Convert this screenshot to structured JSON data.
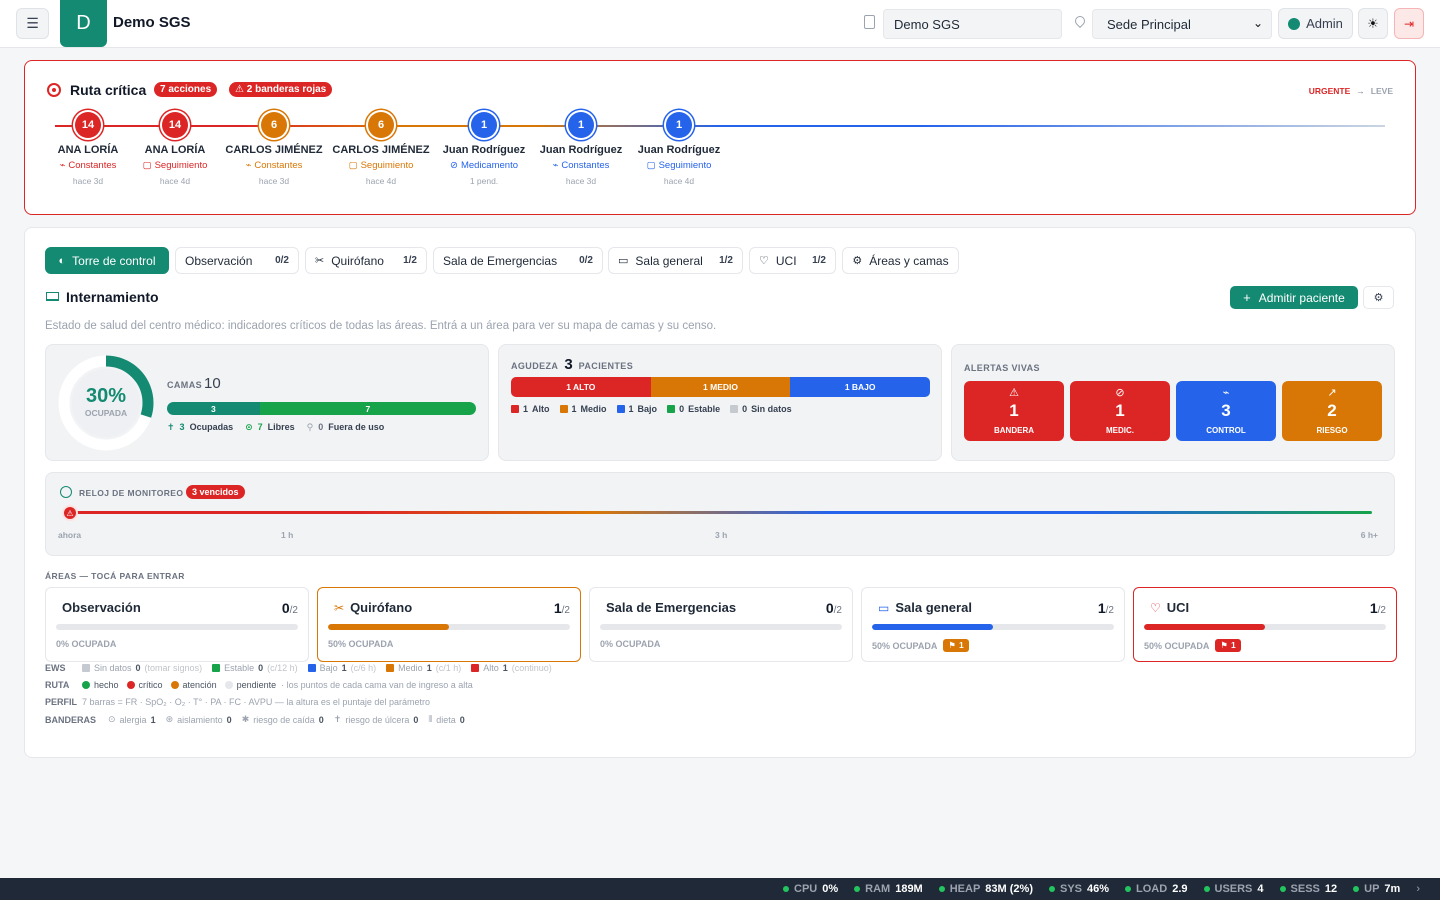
{
  "header": {
    "org_name": "Demo SGS",
    "org_field": "Demo SGS",
    "site": "Sede Principal",
    "user": "Admin"
  },
  "critical": {
    "title": "Ruta crítica",
    "actions_badge": "7 acciones",
    "flags_badge": "⚠ 2 banderas rojas",
    "scale_from": "URGENTE",
    "scale_arrow": "→",
    "scale_to": "LEVE",
    "nodes": [
      {
        "score": "14",
        "name": "ANA LORÍA",
        "label": "Constantes",
        "ago": "hace 3d",
        "color": "#dc2626"
      },
      {
        "score": "14",
        "name": "ANA LORÍA",
        "label": "Seguimiento",
        "ago": "hace 4d",
        "color": "#dc2626"
      },
      {
        "score": "6",
        "name": "CARLOS JIMÉNEZ",
        "label": "Constantes",
        "ago": "hace 3d",
        "color": "#d97706"
      },
      {
        "score": "6",
        "name": "CARLOS JIMÉNEZ",
        "label": "Seguimiento",
        "ago": "hace 4d",
        "color": "#d97706"
      },
      {
        "score": "1",
        "name": "Juan Rodríguez",
        "label": "Medicamento",
        "ago": "1 pend.",
        "color": "#2563eb"
      },
      {
        "score": "1",
        "name": "Juan Rodríguez",
        "label": "Constantes",
        "ago": "hace 3d",
        "color": "#2563eb"
      },
      {
        "score": "1",
        "name": "Juan Rodríguez",
        "label": "Seguimiento",
        "ago": "hace 4d",
        "color": "#2563eb"
      }
    ]
  },
  "tabs": [
    {
      "label": "Torre de control",
      "count": ""
    },
    {
      "label": "Observación",
      "count": "0/2"
    },
    {
      "label": "Quirófano",
      "count": "1/2"
    },
    {
      "label": "Sala de Emergencias",
      "count": "0/2"
    },
    {
      "label": "Sala general",
      "count": "1/2"
    },
    {
      "label": "UCI",
      "count": "1/2"
    },
    {
      "label": "Áreas y camas",
      "count": ""
    }
  ],
  "section": {
    "title": "Internamiento",
    "admit_label": "Admitir paciente",
    "description": "Estado de salud del centro médico: indicadores críticos de todas las áreas. Entrá a un área para ver su mapa de camas y su censo."
  },
  "occupancy": {
    "percent": "30%",
    "percent_value": 30,
    "caption": "OCUPADA",
    "beds_label": "CAMAS",
    "beds_total": "10",
    "occupied_bar": "3",
    "free_bar": "7",
    "occupied_value": 3,
    "free_value": 7,
    "occupied_count": "3",
    "occupied_text": "Ocupadas",
    "free_count": "7",
    "free_text": "Libres",
    "out_count": "0",
    "out_text": "Fuera de uso"
  },
  "acuity": {
    "label": "AGUDEZA",
    "count": "3",
    "patients_label": "PACIENTES",
    "segments": [
      {
        "text": "1 ALTO",
        "value": 1,
        "color": "#dc2626"
      },
      {
        "text": "1 MEDIO",
        "value": 1,
        "color": "#d97706"
      },
      {
        "text": "1 BAJO",
        "value": 1,
        "color": "#2563eb"
      }
    ],
    "legend": [
      {
        "n": "1",
        "t": "Alto",
        "color": "#dc2626"
      },
      {
        "n": "1",
        "t": "Medio",
        "color": "#d97706"
      },
      {
        "n": "1",
        "t": "Bajo",
        "color": "#2563eb"
      },
      {
        "n": "0",
        "t": "Estable",
        "color": "#16a34a"
      },
      {
        "n": "0",
        "t": "Sin datos",
        "color": "#c5c9d0"
      }
    ]
  },
  "alerts": {
    "title": "ALERTAS VIVAS",
    "items": [
      {
        "value": "1",
        "label": "BANDERA",
        "color": "#dc2626",
        "icon": "warning-icon"
      },
      {
        "value": "1",
        "label": "MEDIC.",
        "color": "#dc2626",
        "icon": "pill-icon"
      },
      {
        "value": "3",
        "label": "CONTROL",
        "color": "#2563eb",
        "icon": "pulse-icon"
      },
      {
        "value": "2",
        "label": "RIESGO",
        "color": "#d97706",
        "icon": "trend-icon"
      }
    ]
  },
  "monitor": {
    "title": "RELOJ DE MONITOREO",
    "overdue_badge": "3 vencidos",
    "ticks": [
      "ahora",
      "1 h",
      "3 h",
      "6 h+"
    ]
  },
  "areas": {
    "caption": "ÁREAS — TOCÁ PARA ENTRAR",
    "items": [
      {
        "name": "Observación",
        "occ": "0",
        "total": "/2",
        "percent_text": "0% OCUPADA",
        "fill": 0,
        "color": "#9ca3af",
        "border": "#e5e7eb",
        "icon": "",
        "badge": ""
      },
      {
        "name": "Quirófano",
        "occ": "1",
        "total": "/2",
        "percent_text": "50% OCUPADA",
        "fill": 0.5,
        "color": "#d97706",
        "border": "#d97706",
        "icon": "scissors-icon",
        "badge": ""
      },
      {
        "name": "Sala de Emergencias",
        "occ": "0",
        "total": "/2",
        "percent_text": "0% OCUPADA",
        "fill": 0,
        "color": "#9ca3af",
        "border": "#e5e7eb",
        "icon": "",
        "badge": ""
      },
      {
        "name": "Sala general",
        "occ": "1",
        "total": "/2",
        "percent_text": "50% OCUPADA",
        "fill": 0.5,
        "color": "#2563eb",
        "border": "#e5e7eb",
        "icon": "bed-icon",
        "badge": "1",
        "badge_color": "#d97706"
      },
      {
        "name": "UCI",
        "occ": "1",
        "total": "/2",
        "percent_text": "50% OCUPADA",
        "fill": 0.5,
        "color": "#dc2626",
        "border": "#dc2626",
        "icon": "heart-icon",
        "badge": "1",
        "badge_color": "#dc2626"
      }
    ]
  },
  "legend": {
    "ews_label": "EWS",
    "ews": [
      {
        "t": "Sin datos",
        "n": "0",
        "hint": "(tomar signos)",
        "color": "#c5c9d0"
      },
      {
        "t": "Estable",
        "n": "0",
        "hint": "(c/12 h)",
        "color": "#16a34a"
      },
      {
        "t": "Bajo",
        "n": "1",
        "hint": "(c/6 h)",
        "color": "#2563eb"
      },
      {
        "t": "Medio",
        "n": "1",
        "hint": "(c/1 h)",
        "color": "#d97706"
      },
      {
        "t": "Alto",
        "n": "1",
        "hint": "(continuo)",
        "color": "#dc2626"
      }
    ],
    "ruta_label": "RUTA",
    "ruta": [
      {
        "t": "hecho",
        "color": "#16a34a"
      },
      {
        "t": "crítico",
        "color": "#dc2626"
      },
      {
        "t": "atención",
        "color": "#d97706"
      },
      {
        "t": "pendiente",
        "color": "#e5e7eb"
      }
    ],
    "ruta_note": "· los puntos de cada cama van de ingreso a alta",
    "perfil_label": "PERFIL",
    "perfil_text": "7 barras = FR · SpO₂ · O₂ · T° · PA · FC · AVPU — la altura es el puntaje del parámetro",
    "banderas_label": "BANDERAS",
    "banderas": [
      {
        "t": "alergia",
        "n": "1"
      },
      {
        "t": "aislamiento",
        "n": "0"
      },
      {
        "t": "riesgo de caída",
        "n": "0"
      },
      {
        "t": "riesgo de úlcera",
        "n": "0"
      },
      {
        "t": "dieta",
        "n": "0"
      }
    ]
  },
  "status": [
    {
      "k": "CPU",
      "v": "0%"
    },
    {
      "k": "RAM",
      "v": "189M"
    },
    {
      "k": "HEAP",
      "v": "83M (2%)"
    },
    {
      "k": "SYS",
      "v": "46%"
    },
    {
      "k": "LOAD",
      "v": "2.9"
    },
    {
      "k": "USERS",
      "v": "4"
    },
    {
      "k": "SESS",
      "v": "12"
    },
    {
      "k": "UP",
      "v": "7m"
    }
  ]
}
